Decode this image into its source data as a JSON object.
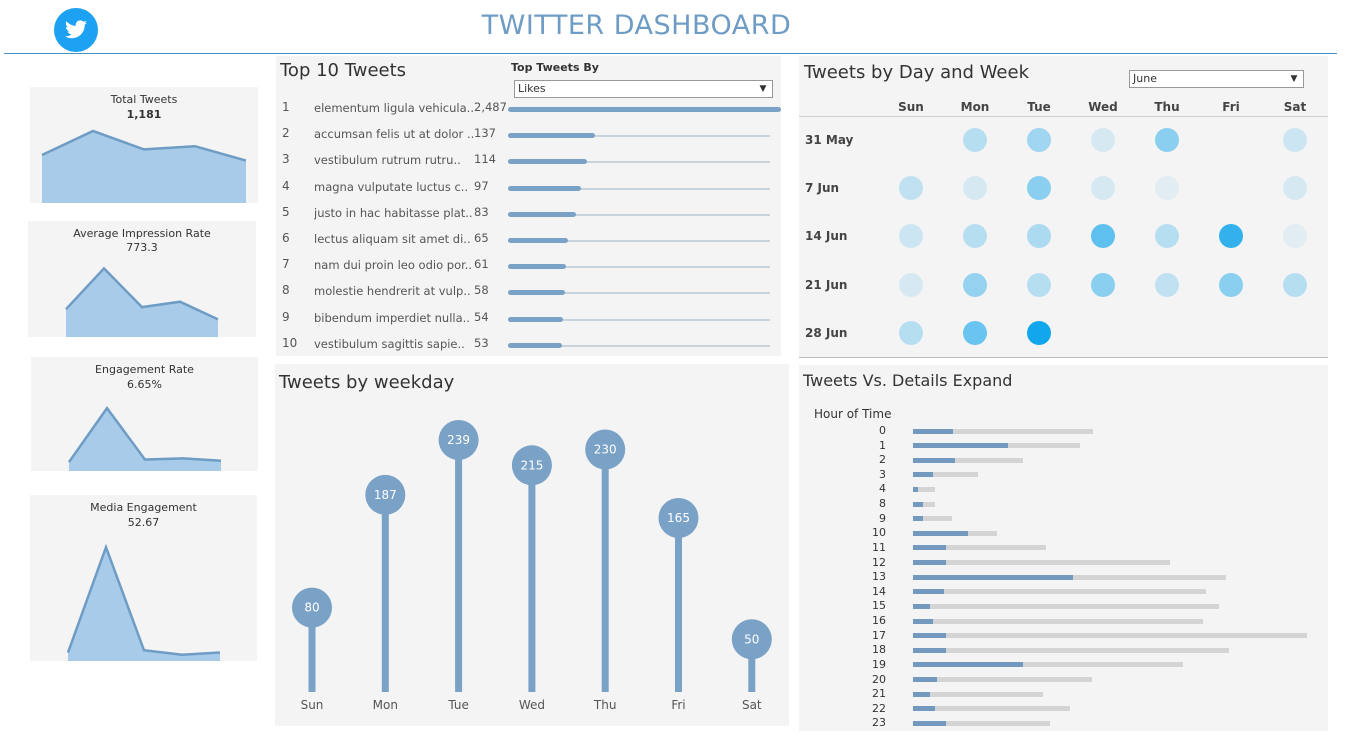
{
  "header": {
    "title": "TWITTER DASHBOARD",
    "logo": "twitter-bird-icon",
    "accent": "#6e9cc4"
  },
  "kpis": [
    {
      "label": "Total Tweets",
      "value": "1,181",
      "trend": [
        0.55,
        0.85,
        0.62,
        0.66,
        0.48
      ]
    },
    {
      "label": "Average Impression Rate",
      "value": "773.3",
      "trend": [
        0.35,
        0.95,
        0.38,
        0.46,
        0.2
      ]
    },
    {
      "label": "Engagement Rate",
      "value": "6.65%",
      "trend": [
        0.08,
        0.95,
        0.12,
        0.14,
        0.1
      ]
    },
    {
      "label": "Media Engagement",
      "value": "52.67",
      "trend": [
        0.04,
        0.98,
        0.06,
        0.02,
        0.04
      ]
    }
  ],
  "top_tweets": {
    "title": "Top 10 Tweets",
    "filter_label": "Top Tweets By",
    "filter_value": "Likes",
    "max": 2487,
    "rows": [
      {
        "rank": "1",
        "text": "elementum ligula vehicula..",
        "value": "2,487",
        "num": 2487
      },
      {
        "rank": "2",
        "text": "accumsan felis ut at dolor ..",
        "value": "137",
        "num": 137
      },
      {
        "rank": "3",
        "text": "vestibulum rutrum rutru..",
        "value": "114",
        "num": 114
      },
      {
        "rank": "4",
        "text": "magna vulputate luctus c..",
        "value": "97",
        "num": 97
      },
      {
        "rank": "5",
        "text": "justo in hac habitasse plat..",
        "value": "83",
        "num": 83
      },
      {
        "rank": "6",
        "text": "lectus aliquam sit amet di..",
        "value": "65",
        "num": 65
      },
      {
        "rank": "7",
        "text": "nam dui proin leo odio por..",
        "value": "61",
        "num": 61
      },
      {
        "rank": "8",
        "text": "molestie hendrerit at vulp..",
        "value": "58",
        "num": 58
      },
      {
        "rank": "9",
        "text": "bibendum imperdiet nulla..",
        "value": "54",
        "num": 54
      },
      {
        "rank": "10",
        "text": "vestibulum sagittis sapie..",
        "value": "53",
        "num": 53
      }
    ]
  },
  "calendar": {
    "title": "Tweets by Day and Week",
    "filter_value": "June",
    "days": [
      "Sun",
      "Mon",
      "Tue",
      "Wed",
      "Thu",
      "Fri",
      "Sat"
    ],
    "weeks": [
      {
        "label": "31 May",
        "levels": [
          null,
          0.25,
          0.35,
          0.1,
          0.45,
          null,
          0.15
        ]
      },
      {
        "label": "7 Jun",
        "levels": [
          0.2,
          0.1,
          0.45,
          0.1,
          0.05,
          null,
          0.1
        ]
      },
      {
        "label": "14 Jun",
        "levels": [
          0.15,
          0.25,
          0.3,
          0.65,
          0.25,
          0.85,
          0.05
        ]
      },
      {
        "label": "21 Jun",
        "levels": [
          0.1,
          0.4,
          0.25,
          0.45,
          0.2,
          0.45,
          0.25
        ]
      },
      {
        "label": "28 Jun",
        "levels": [
          0.25,
          0.6,
          1.0,
          null,
          null,
          null,
          null
        ]
      }
    ]
  },
  "chart_data": [
    {
      "type": "bar",
      "title": "Tweets by weekday",
      "categories": [
        "Sun",
        "Mon",
        "Tue",
        "Wed",
        "Thu",
        "Fri",
        "Sat"
      ],
      "values": [
        80,
        187,
        239,
        215,
        230,
        165,
        50
      ]
    },
    {
      "type": "bar",
      "title": "Tweets Vs. Details Expand",
      "ylabel": "Hour of Time",
      "categories": [
        "0",
        "1",
        "2",
        "3",
        "4",
        "8",
        "9",
        "10",
        "11",
        "12",
        "13",
        "14",
        "15",
        "16",
        "17",
        "18",
        "19",
        "20",
        "21",
        "22",
        "23"
      ],
      "series": [
        {
          "values": [
            40,
            95,
            42,
            20,
            5,
            10,
            10,
            55,
            33,
            33,
            160,
            31,
            17,
            20,
            33,
            33,
            110,
            24,
            17,
            22,
            33
          ]
        },
        {
          "values": [
            180,
            167,
            110,
            65,
            22,
            22,
            39,
            84,
            133,
            257,
            313,
            293,
            306,
            290,
            394,
            316,
            270,
            179,
            130,
            157,
            137
          ]
        }
      ]
    }
  ]
}
